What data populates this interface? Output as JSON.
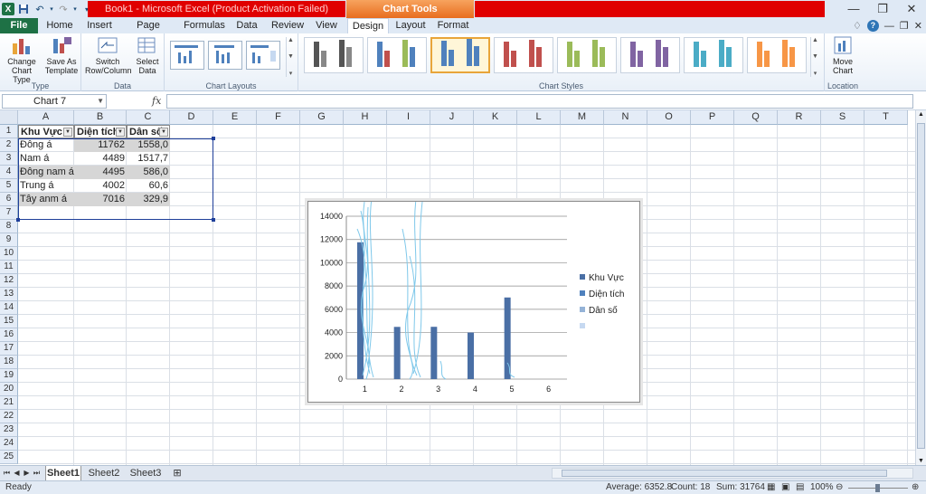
{
  "title_bar": {
    "window_title": "Book1 - Microsoft Excel (Product Activation Failed)",
    "contextual_header": "Chart Tools",
    "window_controls": [
      "—",
      "❐",
      "✕"
    ]
  },
  "ribbon_tabs": [
    "File",
    "Home",
    "Insert",
    "Page Layout",
    "Formulas",
    "Data",
    "Review",
    "View",
    "Design",
    "Layout",
    "Format"
  ],
  "active_tab": "Design",
  "ribbon": {
    "type_group": {
      "label": "Type",
      "change_chart_type": "Change Chart Type",
      "save_as_template": "Save As Template"
    },
    "data_group": {
      "label": "Data",
      "switch_row_column": "Switch Row/Column",
      "select_data": "Select Data"
    },
    "chart_layouts": {
      "label": "Chart Layouts"
    },
    "chart_styles": {
      "label": "Chart Styles",
      "selected_index": 2
    },
    "location_group": {
      "label": "Location",
      "move_chart": "Move Chart"
    }
  },
  "formula_bar": {
    "name_box": "Chart 7",
    "fx": "fx",
    "formula": ""
  },
  "columns": [
    "A",
    "B",
    "C",
    "D",
    "E",
    "F",
    "G",
    "H",
    "I",
    "J",
    "K",
    "L",
    "M",
    "N",
    "O",
    "P",
    "Q",
    "R",
    "S",
    "T"
  ],
  "rows": [
    "1",
    "2",
    "3",
    "4",
    "5",
    "6",
    "7",
    "8",
    "9",
    "10",
    "11",
    "12",
    "13",
    "14",
    "15",
    "16",
    "17",
    "18",
    "19",
    "20",
    "21",
    "22",
    "23",
    "24",
    "25"
  ],
  "table": {
    "headers": [
      "Khu Vực",
      "Diện tích",
      "Dân số"
    ],
    "rows": [
      [
        "Đông á",
        "11762",
        "1558,0"
      ],
      [
        "Nam á",
        "4489",
        "1517,7"
      ],
      [
        "Đông nam á",
        "4495",
        "586,0"
      ],
      [
        "Trung á",
        "4002",
        "60,6"
      ],
      [
        "Tây  anm á",
        "7016",
        "329,9"
      ]
    ]
  },
  "chart_data": {
    "type": "bar",
    "categories": [
      "1",
      "2",
      "3",
      "4",
      "5",
      "6"
    ],
    "series": [
      {
        "name": "Khu Vực",
        "values": [
          11762,
          4489,
          4495,
          4002,
          7016,
          null
        ]
      },
      {
        "name": "Diện tích",
        "values": [
          null,
          null,
          null,
          null,
          null,
          null
        ]
      },
      {
        "name": "Dân số",
        "values": [
          null,
          null,
          null,
          null,
          null,
          null
        ]
      }
    ],
    "ylim": [
      0,
      14000
    ],
    "yticks": [
      "0",
      "2000",
      "4000",
      "6000",
      "8000",
      "10000",
      "12000",
      "14000"
    ],
    "legend": [
      "Khu Vực",
      "Diện tích",
      "Dân số",
      ""
    ],
    "legend_position": "right",
    "grid": true
  },
  "sheets": [
    "Sheet1",
    "Sheet2",
    "Sheet3"
  ],
  "active_sheet": "Sheet1",
  "status": {
    "ready": "Ready",
    "average": "Average: 6352.8",
    "count": "Count: 18",
    "sum": "Sum: 31764",
    "zoom": "100%"
  },
  "colors": {
    "excel_green": "#1e7145",
    "series1": "#4a6fa5",
    "series2": "#4f81bd",
    "series3": "#95b3d7",
    "scribble": "#7fc8ea",
    "title_red": "#e00000"
  }
}
